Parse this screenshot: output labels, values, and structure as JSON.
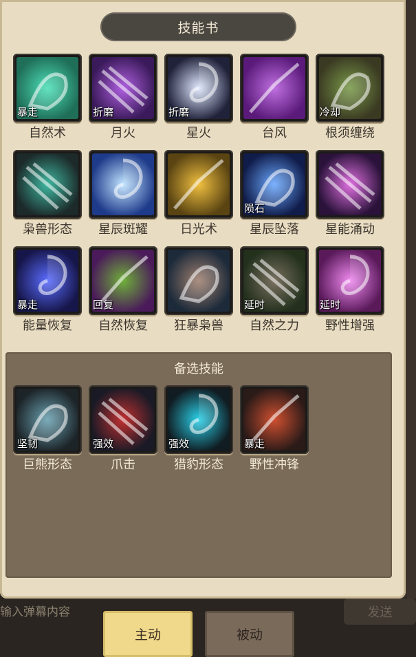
{
  "panel": {
    "title": "技能书"
  },
  "skills": [
    {
      "name": "自然术",
      "tag": "暴走",
      "icon": "nature-bloom-icon",
      "colors": [
        "#1f6e58",
        "#4de0b8"
      ]
    },
    {
      "name": "月火",
      "tag": "折磨",
      "icon": "moonfire-icon",
      "colors": [
        "#3a1a5a",
        "#b060e0"
      ]
    },
    {
      "name": "星火",
      "tag": "折磨",
      "icon": "starfire-icon",
      "colors": [
        "#20223a",
        "#dfe8ff"
      ]
    },
    {
      "name": "台风",
      "tag": "",
      "icon": "typhoon-swirl-icon",
      "colors": [
        "#5a1a7a",
        "#c070e0"
      ]
    },
    {
      "name": "根须缠绕",
      "tag": "冷却",
      "icon": "entangling-roots-icon",
      "colors": [
        "#3a3a22",
        "#7a9a4a"
      ]
    },
    {
      "name": "枭兽形态",
      "tag": "",
      "icon": "moonkin-form-icon",
      "colors": [
        "#1c2a2a",
        "#3fb7a0"
      ]
    },
    {
      "name": "星辰斑耀",
      "tag": "",
      "icon": "starbeam-icon",
      "colors": [
        "#1e3a8a",
        "#bfe3ff"
      ]
    },
    {
      "name": "日光术",
      "tag": "",
      "icon": "sunlight-icon",
      "colors": [
        "#5a4412",
        "#f0c040"
      ]
    },
    {
      "name": "星辰坠落",
      "tag": "陨石",
      "icon": "starfall-meteor-icon",
      "colors": [
        "#101c4a",
        "#6aa8ff"
      ]
    },
    {
      "name": "星能涌动",
      "tag": "",
      "icon": "astral-surge-icon",
      "colors": [
        "#2a123a",
        "#e070e0"
      ]
    },
    {
      "name": "能量恢复",
      "tag": "暴走",
      "icon": "lightning-restore-icon",
      "colors": [
        "#16164a",
        "#5a6cff"
      ]
    },
    {
      "name": "自然恢复",
      "tag": "回复",
      "icon": "leaf-restore-icon",
      "colors": [
        "#4a1a5a",
        "#6fb03a"
      ]
    },
    {
      "name": "狂暴枭兽",
      "tag": "",
      "icon": "berserk-moonkin-icon",
      "colors": [
        "#1c2a3a",
        "#a08070"
      ]
    },
    {
      "name": "自然之力",
      "tag": "延时",
      "icon": "treant-force-icon",
      "colors": [
        "#22301c",
        "#7a7060"
      ]
    },
    {
      "name": "野性增强",
      "tag": "延时",
      "icon": "wild-paw-icon",
      "colors": [
        "#5a1a5a",
        "#f08af0"
      ]
    }
  ],
  "reserve": {
    "title": "备选技能",
    "skills": [
      {
        "name": "巨熊形态",
        "tag": "坚韧",
        "icon": "bear-form-icon",
        "colors": [
          "#1c2428",
          "#6aa0b0"
        ]
      },
      {
        "name": "爪击",
        "tag": "强效",
        "icon": "claw-strike-icon",
        "colors": [
          "#1a1a26",
          "#c03030"
        ]
      },
      {
        "name": "猎豹形态",
        "tag": "强效",
        "icon": "cheetah-form-icon",
        "colors": [
          "#101c22",
          "#2ad0e8"
        ]
      },
      {
        "name": "野性冲锋",
        "tag": "暴走",
        "icon": "wild-charge-icon",
        "colors": [
          "#2a1a18",
          "#d05030"
        ]
      }
    ]
  },
  "chat": {
    "placeholder": "输入弹幕内容",
    "send": "发送"
  },
  "tabs": {
    "active": "主动",
    "inactive": "被动"
  }
}
